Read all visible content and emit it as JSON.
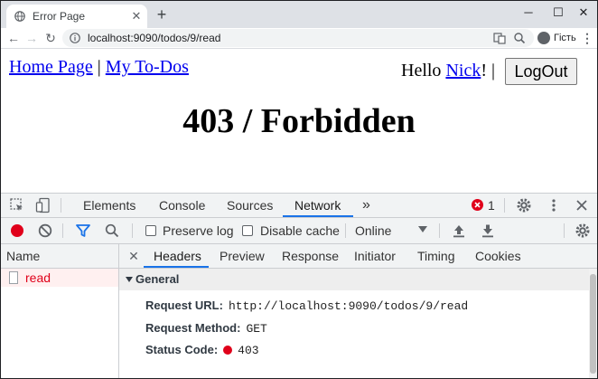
{
  "browser": {
    "tab_title": "Error Page",
    "tab_close": "✕",
    "new_tab": "+",
    "window_controls": [
      "─",
      "☐",
      "✕"
    ],
    "nav": {
      "back": "←",
      "forward": "→",
      "reload": "↻"
    },
    "url": "localhost:9090/todos/9/read",
    "profile_label": "Гість",
    "menu": "⋮"
  },
  "page": {
    "link_home": "Home Page",
    "separator": "|",
    "link_todos": "My To-Dos",
    "hello_prefix": "Hello ",
    "user_name": "Nick",
    "hello_suffix": "! |",
    "logout_label": "LogOut",
    "heading": "403 / Forbidden"
  },
  "devtools": {
    "tabs": [
      "Elements",
      "Console",
      "Sources",
      "Network"
    ],
    "active_tab": "Network",
    "more": "»",
    "error_count": "1",
    "toolbar": {
      "preserve_log": "Preserve log",
      "disable_cache": "Disable cache",
      "throttle": "Online"
    },
    "name_header": "Name",
    "request_name": "read",
    "sub_tabs": [
      "Headers",
      "Preview",
      "Response",
      "Initiator",
      "Timing",
      "Cookies"
    ],
    "sub_close": "✕",
    "general_label": "General",
    "headers": [
      {
        "key": "Request URL:",
        "value": "http://localhost:9090/todos/9/read"
      },
      {
        "key": "Request Method:",
        "value": "GET"
      },
      {
        "key": "Status Code:",
        "value": "403"
      }
    ],
    "colors": {
      "accent": "#1a73e8",
      "error": "#e0001a"
    }
  }
}
